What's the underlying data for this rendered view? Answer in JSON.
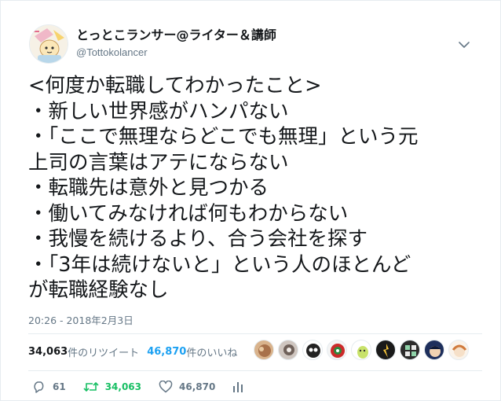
{
  "user": {
    "display_name": "とっとこランサー@ライター＆講師",
    "handle": "@Tottokolancer"
  },
  "tweet": {
    "lines": [
      "<何度か転職してわかったこと>",
      "・新しい世界感がハンパない",
      "・「ここで無理ならどこでも無理」という元",
      "上司の言葉はアテにならない",
      "・転職先は意外と見つかる",
      "・働いてみなければ何もわからない",
      "・我慢を続けるより、合う会社を探す",
      "・「3年は続けないと」という人のほとんど",
      "が転職経験なし"
    ],
    "timestamp": "20:26 - 2018年2月3日"
  },
  "stats": {
    "retweets_count": "34,063",
    "retweets_label": "件のリツイート",
    "likes_count": "46,870",
    "likes_label": "件のいいね"
  },
  "actions": {
    "reply_count": "61",
    "retweet_count": "34,063",
    "like_count": "46,870"
  },
  "icons": {
    "caret": "chevron-down-icon",
    "reply": "reply-icon",
    "retweet": "retweet-icon",
    "like": "heart-icon",
    "analytics": "analytics-icon"
  },
  "colors": {
    "accent": "#1da1f2",
    "retweet_green": "#17bf63",
    "secondary_text": "#657786"
  }
}
